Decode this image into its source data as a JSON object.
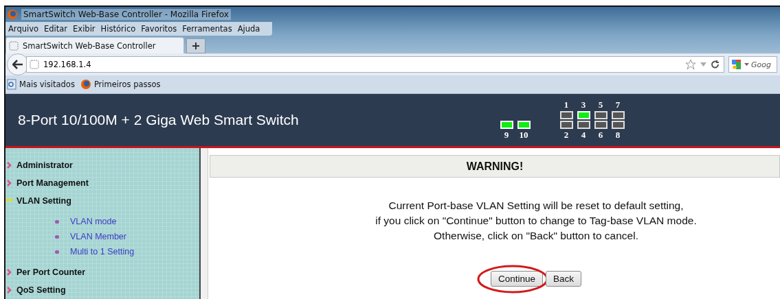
{
  "window": {
    "title": "SmartSwitch Web-Base Controller - Mozilla Firefox"
  },
  "menu": [
    "Arquivo",
    "Editar",
    "Exibir",
    "Histórico",
    "Favoritos",
    "Ferramentas",
    "Ajuda"
  ],
  "tabs": [
    {
      "label": "SmartSwitch Web-Base Controller",
      "selected": true
    }
  ],
  "address": {
    "value": "192.168.1.4"
  },
  "search": {
    "value": "Goog"
  },
  "bookmarks": [
    {
      "label": "Mais visitados",
      "kind": "page"
    },
    {
      "label": "Primeiros passos",
      "kind": "browser"
    }
  ],
  "header": {
    "title": "8-Port 10/100M + 2 Giga Web Smart Switch",
    "giga_ports": [
      {
        "label": "9",
        "link": true
      },
      {
        "label": "10",
        "link": true
      }
    ],
    "top_ports": [
      {
        "label": "1",
        "link": false
      },
      {
        "label": "3",
        "link": true
      },
      {
        "label": "5",
        "link": false
      },
      {
        "label": "7",
        "link": false
      }
    ],
    "bottom_ports": [
      {
        "label": "2",
        "link": false
      },
      {
        "label": "4",
        "link": false
      },
      {
        "label": "6",
        "link": false
      },
      {
        "label": "8",
        "link": false
      }
    ]
  },
  "sidebar": {
    "items": [
      {
        "label": "Administrator",
        "expanded": false
      },
      {
        "label": "Port Management",
        "expanded": false
      },
      {
        "label": "VLAN Setting",
        "expanded": true,
        "children": [
          {
            "label": "VLAN mode"
          },
          {
            "label": "VLAN Member"
          },
          {
            "label": "Multi to 1 Setting"
          }
        ]
      },
      {
        "label": "Per Port Counter",
        "expanded": false
      },
      {
        "label": "QoS Setting",
        "expanded": false
      }
    ]
  },
  "content": {
    "heading": "WARNING!",
    "message": [
      "Current Port-base VLAN Setting will be reset to default setting,",
      "if you click on \"Continue\" button to change to Tag-base VLAN mode.",
      "Otherwise, click on \"Back\" button to cancel."
    ],
    "buttons": [
      {
        "label": "Continue",
        "highlighted": true
      },
      {
        "label": "Back",
        "highlighted": false
      }
    ]
  }
}
